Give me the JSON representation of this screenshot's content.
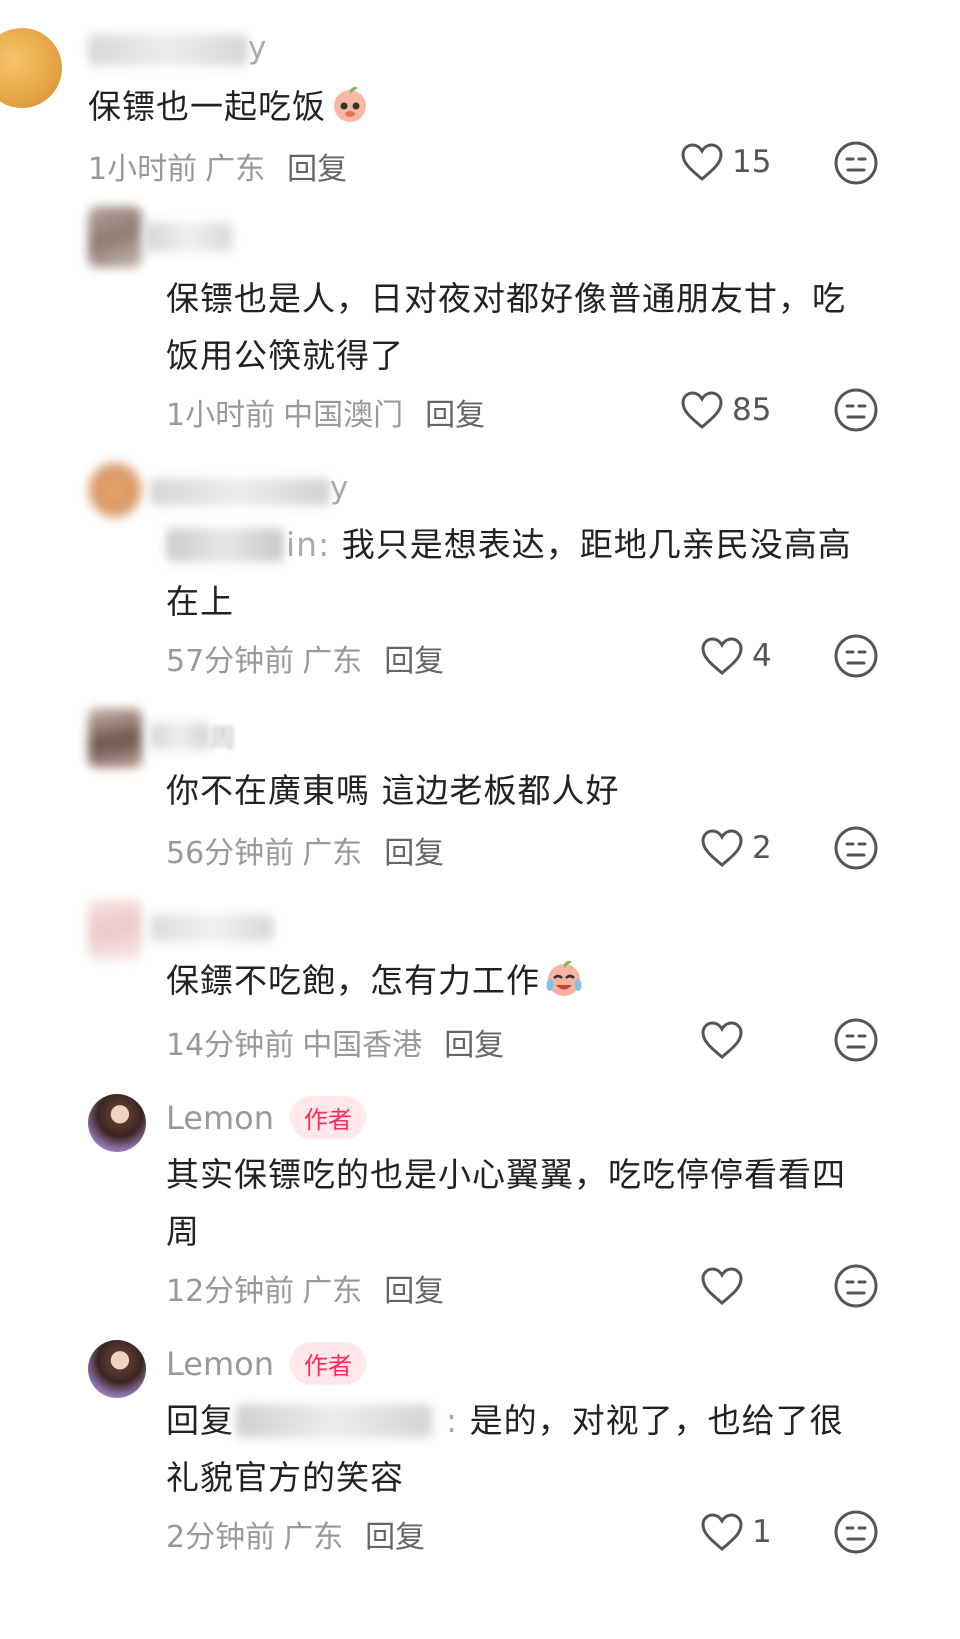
{
  "comments": [
    {
      "name_suffix": "y",
      "text": "保镖也一起吃饭",
      "time": "1小时前",
      "location": "广东",
      "reply": "回复",
      "likes": "15"
    },
    {
      "text": "保镖也是人，日对夜对都好像普通朋友甘，吃饭用公筷就得了",
      "time": "1小时前",
      "location": "中国澳门",
      "reply": "回复",
      "likes": "85"
    },
    {
      "name_suffix": "y",
      "mention_suffix": "in:",
      "text": "我只是想表达，距地几亲民没高高在上",
      "time": "57分钟前",
      "location": "广东",
      "reply": "回复",
      "likes": "4"
    },
    {
      "name_suffix": "周",
      "text": "你不在廣東嗎 這边老板都人好",
      "time": "56分钟前",
      "location": "广东",
      "reply": "回复",
      "likes": "2"
    },
    {
      "text": "保鏢不吃飽，怎有力工作",
      "time": "14分钟前",
      "location": "中国香港",
      "reply": "回复",
      "likes": ""
    },
    {
      "name": "Lemon",
      "badge": "作者",
      "text": "其实保镖吃的也是小心翼翼，吃吃停停看看四周",
      "time": "12分钟前",
      "location": "广东",
      "reply": "回复",
      "likes": ""
    },
    {
      "name": "Lemon",
      "badge": "作者",
      "reply_prefix": "回复",
      "text": "是的，对视了，也给了很礼貌官方的笑容",
      "time": "2分钟前",
      "location": "广东",
      "reply": "回复",
      "likes": "1"
    }
  ],
  "icons": {
    "like": "heart-outline-icon",
    "dislike": "unamused-face-icon",
    "emoji_1": "peach-face-emoji",
    "emoji_2": "crying-laughing-emoji"
  },
  "colors": {
    "text": "#222222",
    "meta": "#999999",
    "author_badge": "#ff2a55",
    "author_badge_bg": "#ffe7ec"
  }
}
